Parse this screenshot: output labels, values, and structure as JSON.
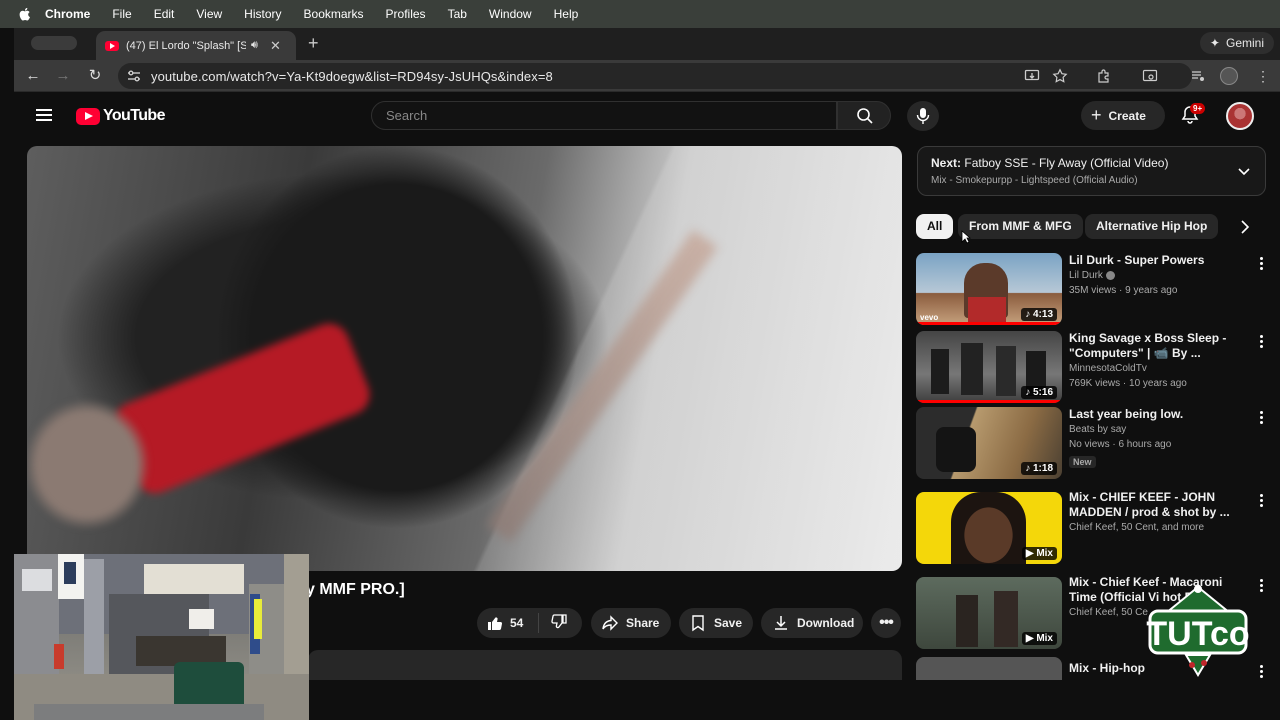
{
  "menubar": {
    "items": [
      "Chrome",
      "File",
      "Edit",
      "View",
      "History",
      "Bookmarks",
      "Profiles",
      "Tab",
      "Window",
      "Help"
    ]
  },
  "browser": {
    "tab_title": "(47) El Lordo \"Splash\" [SI",
    "url": "youtube.com/watch?v=Ya-Kt9doegw&list=RD94sy-JsUHQs&index=8",
    "gemini_label": "Gemini"
  },
  "youtube": {
    "logo_text": "YouTube",
    "search_placeholder": "Search",
    "create_label": "Create",
    "notif_count": "9+",
    "accent": "#ff0033"
  },
  "video": {
    "title_visible": "y MMF PRO.]",
    "likes": "54",
    "share_label": "Share",
    "save_label": "Save",
    "download_label": "Download"
  },
  "upnext": {
    "prefix": "Next:",
    "title": "Fatboy SSE - Fly Away (Official Video)",
    "subtitle": "Mix - Smokepurpp - Lightspeed (Official Audio)"
  },
  "chips": [
    "All",
    "From MMF & MFG",
    "Alternative Hip Hop"
  ],
  "recommendations": [
    {
      "title": "Lil Durk - Super Powers",
      "channel": "Lil Durk",
      "stats": "35M views · 9 years ago",
      "duration": "4:13",
      "verified": true
    },
    {
      "title": "King Savage x Boss Sleep - \"Computers\" | 📹 By ...",
      "channel": "MinnesotaColdTv",
      "stats": "769K views · 10 years ago",
      "duration": "5:16"
    },
    {
      "title": "Last year being low.",
      "channel": "Beats by say",
      "stats": "No views · 6 hours ago",
      "duration": "1:18",
      "badge": "New"
    },
    {
      "title": "Mix - CHIEF KEEF - JOHN MADDEN /  prod & shot by ...",
      "channel": "Chief Keef, 50 Cent, and more",
      "duration": "Mix"
    },
    {
      "title": "Mix - Chief Keef - Macaroni Time (Official Vi   hot E...",
      "channel": "Chief Keef, 50 Ce",
      "duration": "Mix"
    },
    {
      "title": "Mix - Hip-hop"
    }
  ],
  "watermark": {
    "text": "TUTco"
  }
}
